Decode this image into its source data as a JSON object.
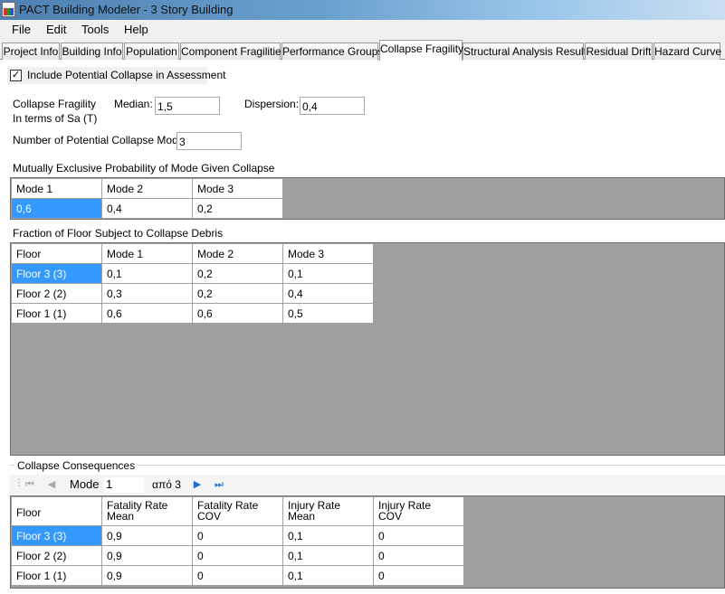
{
  "window": {
    "title": "PACT Building Modeler - 3 Story Building"
  },
  "menu": [
    "File",
    "Edit",
    "Tools",
    "Help"
  ],
  "tabs": [
    "Project Info",
    "Building Info",
    "Population",
    "Component Fragilities",
    "Performance Groups",
    "Collapse Fragility",
    "Structural Analysis Results",
    "Residual Drift",
    "Hazard Curve"
  ],
  "active_tab": "Collapse Fragility",
  "include_collapse": {
    "label": "Include Potential Collapse in Assessment",
    "checked": true,
    "mark": "✓"
  },
  "fragility": {
    "label_line1": "Collapse Fragility",
    "label_line2": "In terms of Sa (T)",
    "median_label": "Median:",
    "median_value": "1,5",
    "dispersion_label": "Dispersion:",
    "dispersion_value": "0,4"
  },
  "modes": {
    "label": "Number of Potential Collapse Modes:",
    "value": "3"
  },
  "mode_probability": {
    "title": "Mutually Exclusive Probability of Mode Given Collapse",
    "headers": [
      "Mode 1",
      "Mode 2",
      "Mode 3"
    ],
    "values": [
      "0,6",
      "0,4",
      "0,2"
    ]
  },
  "floor_fraction": {
    "title": "Fraction of Floor Subject to Collapse Debris",
    "headers": [
      "Floor",
      "Mode 1",
      "Mode 2",
      "Mode 3"
    ],
    "rows": [
      [
        "Floor 3 (3)",
        "0,1",
        "0,2",
        "0,1"
      ],
      [
        "Floor 2 (2)",
        "0,3",
        "0,2",
        "0,4"
      ],
      [
        "Floor 1 (1)",
        "0,6",
        "0,6",
        "0,5"
      ]
    ]
  },
  "consequences": {
    "title": "Collapse Consequences",
    "nav": {
      "mode_label": "Mode",
      "mode_value": "1",
      "of_text": "από 3"
    },
    "headers": [
      [
        "Floor",
        ""
      ],
      [
        "Fatality Rate",
        "Mean"
      ],
      [
        "Fatality Rate",
        "COV"
      ],
      [
        "Injury Rate",
        "Mean"
      ],
      [
        "Injury Rate",
        "COV"
      ]
    ],
    "rows": [
      [
        "Floor 3 (3)",
        "0,9",
        "0",
        "0,1",
        "0"
      ],
      [
        "Floor 2 (2)",
        "0,9",
        "0",
        "0,1",
        "0"
      ],
      [
        "Floor 1 (1)",
        "0,9",
        "0",
        "0,1",
        "0"
      ]
    ]
  },
  "icons": {
    "first": "first-page-icon",
    "prev": "previous-icon",
    "next": "next-icon",
    "last": "last-page-icon"
  },
  "colors": {
    "selection": "#3399ff",
    "grid_background": "#a0a0a0"
  }
}
